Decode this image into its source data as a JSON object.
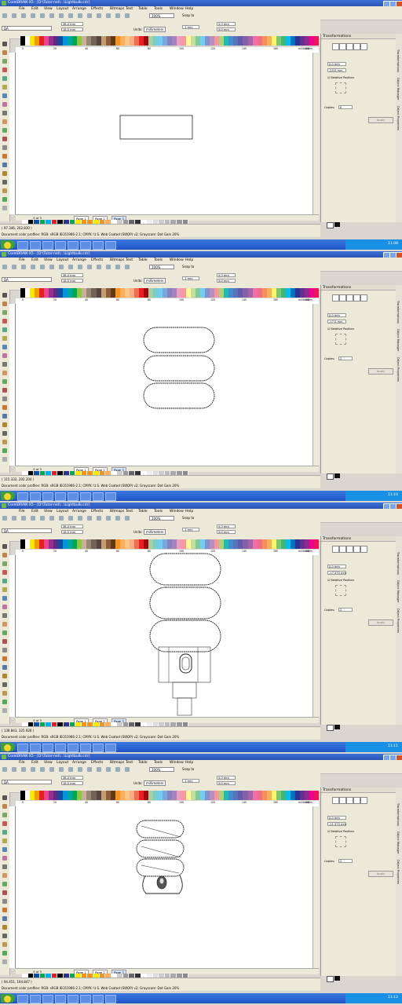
{
  "frames": [
    {
      "title": "CorelDRAW X5 - [D:\\Tutor-net\\...\\Lightbulb.cdr]",
      "zoom": "100%",
      "width": "38.0 mm",
      "height": "18.0 mm",
      "coords": "( 97.346, 202.830 )",
      "pos_x": "0.0 mm",
      "pos_y": "-20.0 mm",
      "copies": "0",
      "clock": "11:08"
    },
    {
      "title": "CorelDRAW X5 - [D:\\Tutor-net\\...\\Lightbulb.cdr]",
      "zoom": "100%",
      "width": "38.0 mm",
      "height": "18.0 mm",
      "coords": "( 115.332, 202.204 )",
      "pos_x": "0.0 mm",
      "pos_y": "-17.0 mm",
      "copies": "2",
      "clock": "11:10"
    },
    {
      "title": "CorelDRAW X5 - [D:\\Tutor-net\\...\\Lightbulb.cdr]",
      "zoom": "100%",
      "width": "38.0 mm",
      "height": "18.0 mm",
      "coords": "( 138.843, 325.926 )",
      "pos_x": "0.0 mm",
      "pos_y": "-17.370 mm",
      "copies": "2",
      "clock": "11:11"
    },
    {
      "title": "CorelDRAW X5 - [D:\\Tutor-net\\...\\Lightbulb.cdr]",
      "zoom": "100%",
      "width": "38.0 mm",
      "height": "18.0 mm",
      "coords": "( 94.451, 194.847 )",
      "pos_x": "0.0 mm",
      "pos_y": "-11.370 mm",
      "copies": "2",
      "clock": "11:12"
    }
  ],
  "menu": [
    "File",
    "Edit",
    "View",
    "Layout",
    "Arrange",
    "Effects",
    "Bitmaps",
    "Text",
    "Table",
    "Tools",
    "Window",
    "Help"
  ],
  "preset": "DA",
  "units_label": "Units:",
  "units_value": "millimeters",
  "nudge": ".1 mm",
  "dup_x": "5.0 mm",
  "dup_y": "5.0 mm",
  "snap": "Snap to",
  "ruler_unit": "millimeters",
  "ruler_ticks": [
    "0",
    "20",
    "40",
    "60",
    "80",
    "100",
    "120",
    "140",
    "160",
    "180"
  ],
  "page_count": "3 of 3",
  "pages": [
    "Page 1",
    "Page 2",
    "Page 3"
  ],
  "profile": "Document color profiles: RGB: sRGB IEC61966-2.1; CMYK: U.S. Web Coated (SWOP) v2; Grayscale: Dot Gain 20%",
  "docker_title": "Transformations",
  "relative_position": "Relative Position",
  "copies_label": "Copies:",
  "apply": "Apply",
  "side_tabs": [
    "Transformations",
    "Object Manager",
    "Object Properties"
  ],
  "colors": {
    "titlebar": "#2a54b8",
    "taskbar": "#1f55c7",
    "start": "#3ea03a",
    "canvas": "#ffffff",
    "chrome": "#ece9d8"
  }
}
